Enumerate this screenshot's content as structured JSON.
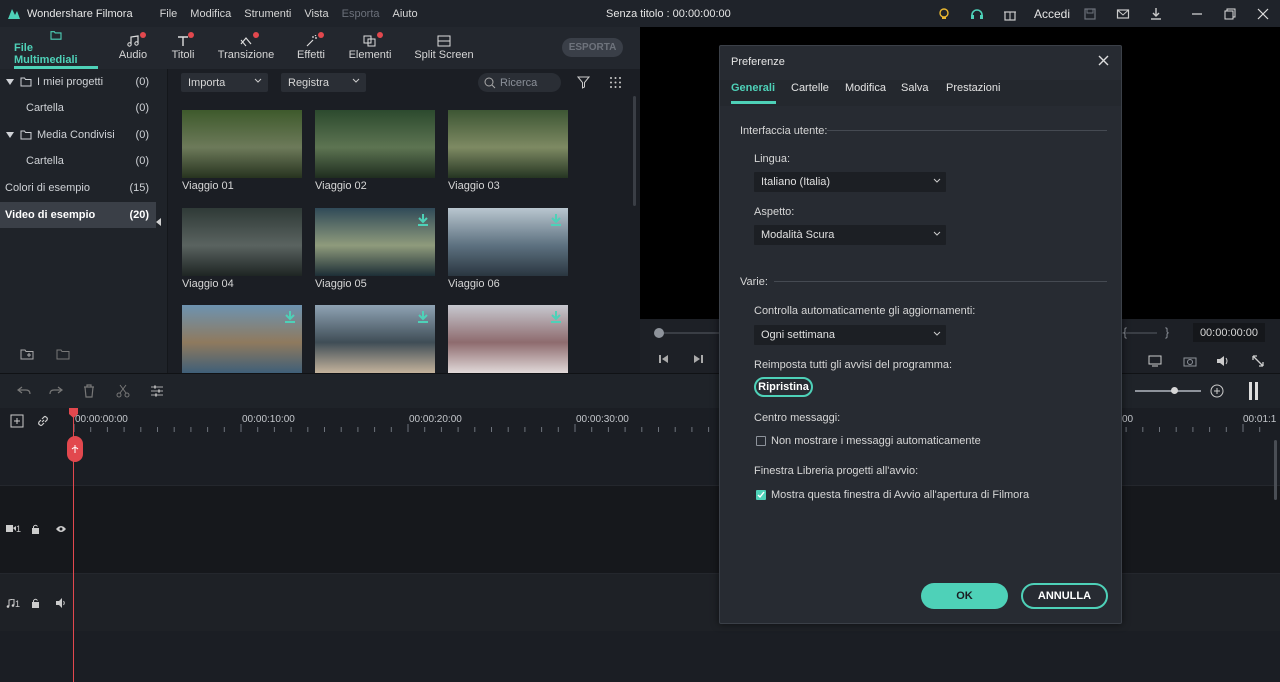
{
  "app": {
    "name": "Wondershare Filmora",
    "project": "Senza titolo : 00:00:00:00"
  },
  "menu": [
    "File",
    "Modifica",
    "Strumenti",
    "Vista",
    "Esporta",
    "Aiuto"
  ],
  "topright": {
    "login_label": "Accedi"
  },
  "media_tabs": [
    {
      "label": "File Multimediali",
      "icon": "folder-icon",
      "active": true,
      "dot": false
    },
    {
      "label": "Audio",
      "icon": "music-note-icon",
      "dot": true
    },
    {
      "label": "Titoli",
      "icon": "title-text-icon",
      "dot": true
    },
    {
      "label": "Transizione",
      "icon": "transition-icon",
      "dot": true
    },
    {
      "label": "Effetti",
      "icon": "effects-icon",
      "dot": true
    },
    {
      "label": "Elementi",
      "icon": "elements-icon",
      "dot": true
    },
    {
      "label": "Split Screen",
      "icon": "split-screen-icon",
      "dot": false
    }
  ],
  "export_button": "ESPORTA",
  "sidebar": {
    "items": [
      {
        "label": "I miei progetti",
        "count": "(0)",
        "folder": true
      },
      {
        "label": "Cartella",
        "count": "(0)",
        "folder": false
      },
      {
        "label": "Media Condivisi",
        "count": "(0)",
        "folder": true
      },
      {
        "label": "Cartella",
        "count": "(0)",
        "folder": false
      },
      {
        "label": "Colori di esempio",
        "count": "(15)",
        "folder": false
      },
      {
        "label": "Video di esempio",
        "count": "(20)",
        "folder": false,
        "selected": true
      }
    ]
  },
  "filters": {
    "import": "Importa",
    "record": "Registra",
    "search_placeholder": "Ricerca"
  },
  "media": [
    {
      "label": "Viaggio 01",
      "colors": [
        "#3e5a2c",
        "#6d7a5a",
        "#27331f"
      ]
    },
    {
      "label": "Viaggio 02",
      "colors": [
        "#2c4a2e",
        "#5d7452",
        "#1f2d1f"
      ]
    },
    {
      "label": "Viaggio 03",
      "colors": [
        "#3d5634",
        "#7e8a63",
        "#253522"
      ]
    },
    {
      "label": "Viaggio 04",
      "colors": [
        "#2f3a37",
        "#5a6360",
        "#1e2523"
      ]
    },
    {
      "label": "Viaggio 05",
      "colors": [
        "#304a58",
        "#8f9b7c",
        "#1d2e36"
      ]
    },
    {
      "label": "Viaggio 06",
      "colors": [
        "#b9c6cf",
        "#5d7180",
        "#2a3640"
      ]
    },
    {
      "label": "",
      "colors": [
        "#6d93b0",
        "#8f7a5e",
        "#3f5f78"
      ]
    },
    {
      "label": "",
      "colors": [
        "#8fa3b4",
        "#3f4d56",
        "#c4b39c"
      ]
    },
    {
      "label": "",
      "colors": [
        "#c7c8cf",
        "#8e6b6e",
        "#e1d9d9"
      ]
    }
  ],
  "preview": {
    "timecode": "00:00:00:00"
  },
  "timeline": {
    "ruler": [
      "00:00:00:00",
      "00:00:10:00",
      "00:00:20:00",
      "00:00:30:00",
      "00",
      "00:01:1"
    ],
    "video_track_label": "1",
    "audio_track_label": "1"
  },
  "dialog": {
    "title": "Preferenze",
    "tabs": [
      "Generali",
      "Cartelle",
      "Modifica",
      "Salva",
      "Prestazioni"
    ],
    "section_ui": "Interfaccia utente:",
    "language_label": "Lingua:",
    "language_value": "Italiano (Italia)",
    "appearance_label": "Aspetto:",
    "appearance_value": "Modalità Scura",
    "section_misc": "Varie:",
    "updates_label": "Controlla automaticamente gli aggiornamenti:",
    "updates_value": "Ogni settimana",
    "reset_label": "Reimposta tutti gli avvisi del programma:",
    "reset_button": "Ripristina",
    "messages_label": "Centro messaggi:",
    "messages_checkbox": "Non mostrare i messaggi automaticamente",
    "messages_checked": false,
    "library_label": "Finestra Libreria progetti all'avvio:",
    "library_checkbox": "Mostra questa finestra di Avvio all'apertura di Filmora",
    "library_checked": true,
    "ok_button": "OK",
    "cancel_button": "ANNULLA"
  },
  "colors": {
    "accent": "#4ed1b8",
    "danger": "#e2484e"
  }
}
